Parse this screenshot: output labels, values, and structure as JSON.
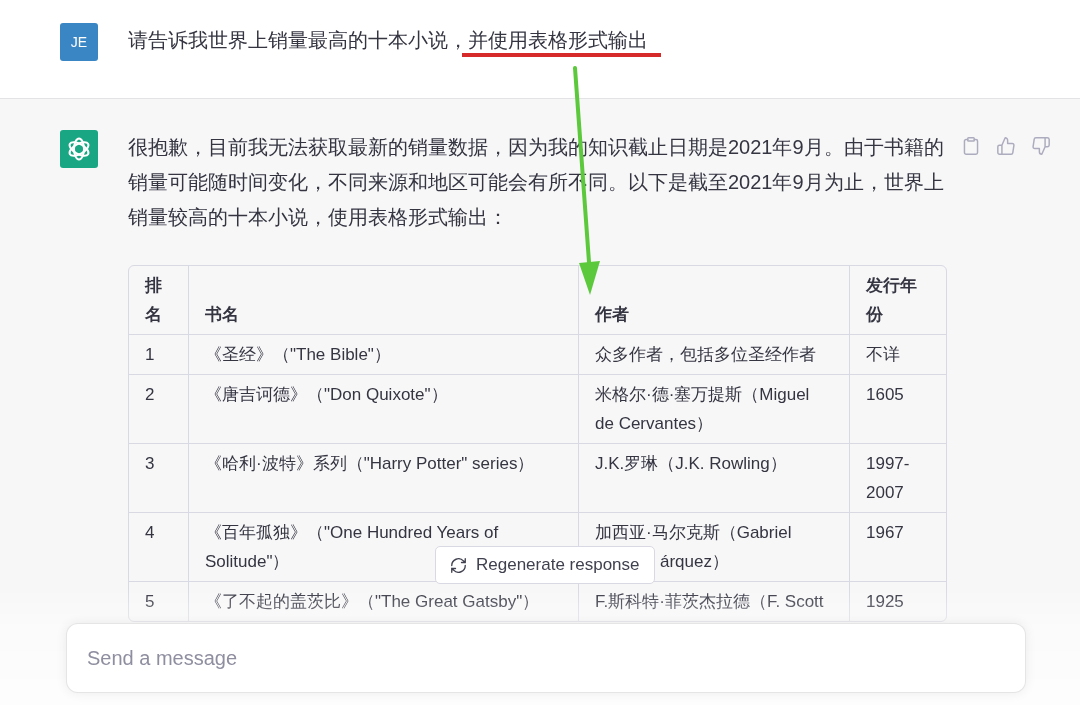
{
  "user_message": {
    "avatar_initials": "JE",
    "text": "请告诉我世界上销量最高的十本小说，并使用表格形式输出"
  },
  "assistant_message": {
    "text": "很抱歉，目前我无法获取最新的销量数据，因为我的知识截止日期是2021年9月。由于书籍的销量可能随时间变化，不同来源和地区可能会有所不同。以下是截至2021年9月为止，世界上销量较高的十本小说，使用表格形式输出：",
    "table": {
      "columns": [
        "排名",
        "书名",
        "作者",
        "发行年份"
      ],
      "rows": [
        [
          "1",
          "《圣经》（\"The Bible\"）",
          "众多作者，包括多位圣经作者",
          "不详"
        ],
        [
          "2",
          "《唐吉诃德》（\"Don Quixote\"）",
          "米格尔·德·塞万提斯（Miguel de Cervantes）",
          "1605"
        ],
        [
          "3",
          "《哈利·波特》系列（\"Harry Potter\" series）",
          "J.K.罗琳（J.K. Rowling）",
          "1997-2007"
        ],
        [
          "4",
          {
            "kind": "wrapped",
            "lines": [
              "《百年孤独》（\"One Hundred Years of",
              "Solitude\"）"
            ]
          },
          {
            "kind": "covered",
            "lines": [
              "加西亚·马尔克斯（Gabriel",
              "árquez）"
            ]
          },
          "1967"
        ],
        [
          "5",
          "《了不起的盖茨比》（\"The Great Gatsby\"）",
          "F.斯科特·菲茨杰拉德（F. Scott",
          "1925"
        ]
      ]
    }
  },
  "annotations": [
    {
      "kind": "underline",
      "color": "#d62a2a"
    },
    {
      "kind": "arrow",
      "color": "#5cc93c"
    }
  ],
  "regenerate_button": {
    "label": "Regenerate response"
  },
  "composer": {
    "placeholder": "Send a message"
  }
}
